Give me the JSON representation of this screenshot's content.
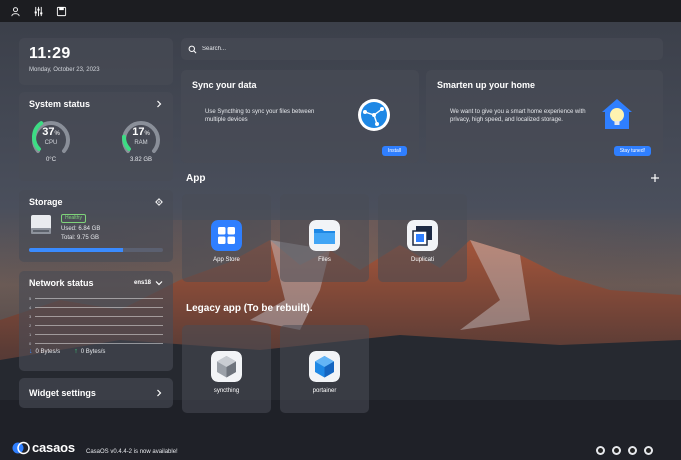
{
  "topbar": {
    "icons": [
      "user-settings-icon",
      "sliders-icon",
      "save-icon"
    ]
  },
  "clock": {
    "time": "11:29",
    "date": "Monday, October 23, 2023"
  },
  "system_status": {
    "title": "System status",
    "cpu": {
      "value": "37",
      "unit": "%",
      "label": "CPU",
      "detail": "0°C",
      "percent": 37,
      "color": "#3ddc84"
    },
    "ram": {
      "value": "17",
      "unit": "%",
      "label": "RAM",
      "detail": "3.82 GB",
      "percent": 17,
      "color": "#3ddc84"
    }
  },
  "storage": {
    "title": "Storage",
    "health": "Healthy",
    "used": "Used: 6.84 GB",
    "total": "Total: 9.75 GB",
    "used_fraction": 0.7
  },
  "network": {
    "title": "Network status",
    "interface": "ens18",
    "ticks": [
      "5",
      "4",
      "3",
      "2",
      "1",
      "0"
    ],
    "download": "0 Bytes/s",
    "upload": "0 Bytes/s"
  },
  "widget_settings": {
    "label": "Widget settings"
  },
  "search": {
    "placeholder": "Search..."
  },
  "sync_card": {
    "title": "Sync your data",
    "text": "Use Syncthing to sync your files between multiple devices",
    "button": "Install"
  },
  "smart_card": {
    "title": "Smarten up your home",
    "text": "We want to give you a smart home experience with privacy, high speed, and localized storage.",
    "button": "Stay tuned!"
  },
  "apps": {
    "heading": "App",
    "items": [
      {
        "label": "App Store"
      },
      {
        "label": "Files"
      },
      {
        "label": "Duplicati"
      }
    ]
  },
  "legacy": {
    "heading": "Legacy app (To be rebuilt).",
    "items": [
      {
        "label": "syncthing"
      },
      {
        "label": "portainer"
      }
    ]
  },
  "footer": {
    "brand": "casaos",
    "note": "CasaOS v0.4.4-2 is now available!",
    "social": [
      "discord-icon",
      "reddit-icon",
      "github-icon",
      "globe-icon"
    ]
  }
}
